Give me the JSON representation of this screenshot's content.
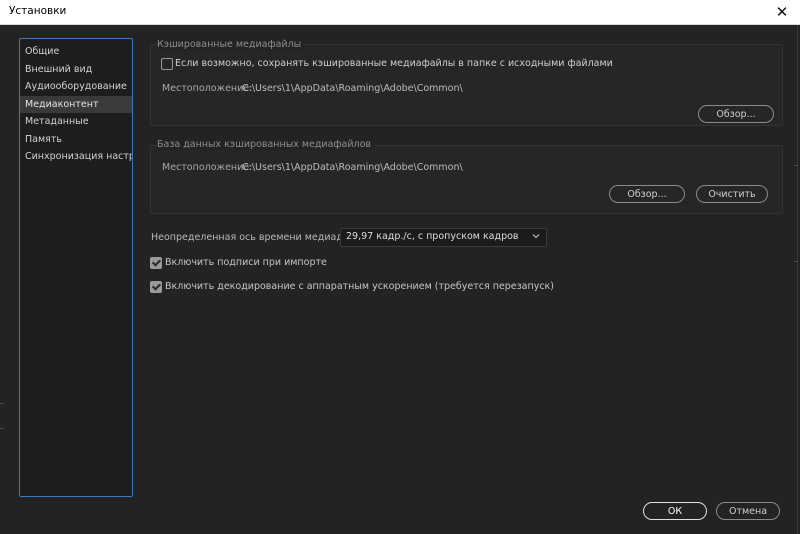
{
  "window": {
    "title": "Установки",
    "close_glyph": "✕"
  },
  "sidebar": {
    "items": [
      {
        "label": "Общие"
      },
      {
        "label": "Внешний вид"
      },
      {
        "label": "Аудиооборудование"
      },
      {
        "label": "Медиаконтент",
        "active": true
      },
      {
        "label": "Метаданные"
      },
      {
        "label": "Память"
      },
      {
        "label": "Синхронизация настроек"
      }
    ]
  },
  "cached_media": {
    "label": "Кэшированные медиафайлы",
    "save_next_to_originals": {
      "label": "Если возможно, сохранять кэшированные медиафайлы в папке с исходными файлами",
      "checked": false
    },
    "location_label": "Местоположение:",
    "location_value": "C:\\Users\\1\\AppData\\Roaming\\Adobe\\Common\\",
    "browse_label": "Обзор..."
  },
  "cache_db": {
    "label": "База данных кэшированных медиафайлов",
    "location_label": "Местоположение:",
    "location_value": "C:\\Users\\1\\AppData\\Roaming\\Adobe\\Common\\",
    "browse_label": "Обзор...",
    "clean_label": "Очистить"
  },
  "timebase": {
    "label": "Неопределенная ось времени медиаданных:",
    "value": "29,97 кадр./с, с пропуском кадров"
  },
  "options": {
    "captions": {
      "label": "Включить подписи при импорте",
      "checked": true
    },
    "hw_decoding": {
      "label": "Включить декодирование с аппаратным ускорением (требуется перезапуск)",
      "checked": true
    }
  },
  "footer": {
    "ok_label": "ОК",
    "cancel_label": "Отмена"
  },
  "colors": {
    "accent": "#3d78c2",
    "background": "#232323"
  }
}
